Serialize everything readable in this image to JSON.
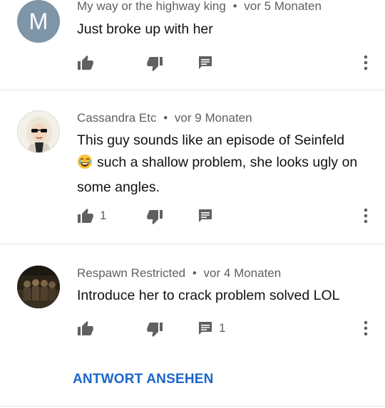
{
  "comments": [
    {
      "author": "My way or the highway king",
      "time": "vor 5 Monaten",
      "text": "Just broke up with her",
      "avatar_letter": "M",
      "avatar_color": "#7f95a8",
      "likes": "",
      "replies": ""
    },
    {
      "author": "Cassandra Etc",
      "time": "vor 9 Monaten",
      "emoji": "😂",
      "text_before": "This guy sounds like an episode of Seinfeld",
      "text_after": "such a shallow problem, she looks ugly on some angles.",
      "likes": "1",
      "replies": ""
    },
    {
      "author": "Respawn Restricted",
      "time": "vor 4 Monaten",
      "text": "Introduce her to crack problem solved LOL",
      "likes": "",
      "replies": "1"
    }
  ],
  "separator": "•",
  "view_replies_label": "ANTWORT ANSEHEN",
  "colors": {
    "link_blue": "#1a66c9",
    "meta_gray": "#606060",
    "icon_gray": "#606060",
    "divider": "#e5e5e5"
  }
}
